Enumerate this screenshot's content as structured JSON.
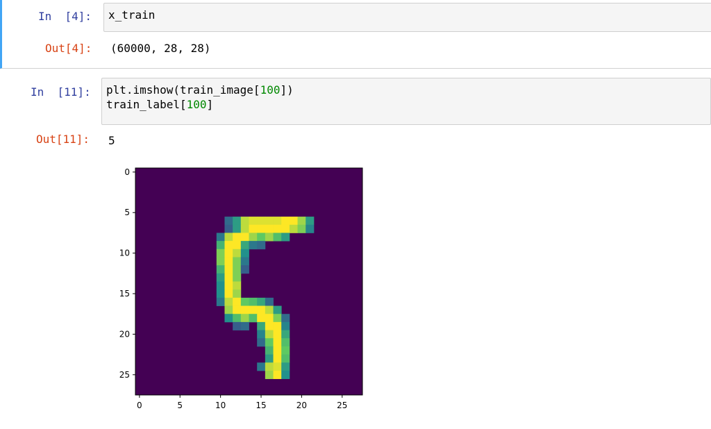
{
  "cells": [
    {
      "in_prompt": "In  [4]:",
      "code_lines": [
        "x_train"
      ],
      "out_prompt": "Out[4]:",
      "output": "(60000, 28, 28)"
    },
    {
      "in_prompt": "In  [11]:",
      "code_line1_a": "plt.imshow(train_image[",
      "code_line1_num": "100",
      "code_line1_b": "])",
      "code_line2_a": "train_label[",
      "code_line2_num": "100",
      "code_line2_b": "]",
      "out_prompt": "Out[11]:",
      "output": "5"
    }
  ],
  "chart_data": {
    "type": "heatmap",
    "title": "",
    "xlabel": "",
    "ylabel": "",
    "xlim": [
      -0.5,
      27.5
    ],
    "ylim": [
      27.5,
      -0.5
    ],
    "x_ticks": [
      0,
      5,
      10,
      15,
      20,
      25
    ],
    "y_ticks": [
      0,
      5,
      10,
      15,
      20,
      25
    ],
    "colormap": "viridis",
    "background_color": "#440154",
    "pixels": [
      [
        6,
        11,
        0.35
      ],
      [
        6,
        12,
        0.55
      ],
      [
        6,
        13,
        0.9
      ],
      [
        6,
        14,
        0.95
      ],
      [
        6,
        15,
        0.95
      ],
      [
        6,
        16,
        0.95
      ],
      [
        6,
        17,
        0.95
      ],
      [
        6,
        18,
        1.0
      ],
      [
        6,
        19,
        1.0
      ],
      [
        6,
        20,
        0.85
      ],
      [
        6,
        21,
        0.55
      ],
      [
        7,
        11,
        0.3
      ],
      [
        7,
        12,
        0.55
      ],
      [
        7,
        13,
        0.9
      ],
      [
        7,
        14,
        1.0
      ],
      [
        7,
        15,
        1.0
      ],
      [
        7,
        16,
        1.0
      ],
      [
        7,
        17,
        1.0
      ],
      [
        7,
        18,
        1.0
      ],
      [
        7,
        19,
        0.9
      ],
      [
        7,
        20,
        0.8
      ],
      [
        7,
        21,
        0.45
      ],
      [
        8,
        10,
        0.4
      ],
      [
        8,
        11,
        0.9
      ],
      [
        8,
        12,
        1.0
      ],
      [
        8,
        13,
        1.0
      ],
      [
        8,
        14,
        0.85
      ],
      [
        8,
        15,
        0.75
      ],
      [
        8,
        16,
        0.85
      ],
      [
        8,
        17,
        0.7
      ],
      [
        8,
        18,
        0.55
      ],
      [
        9,
        10,
        0.65
      ],
      [
        9,
        11,
        1.0
      ],
      [
        9,
        12,
        1.0
      ],
      [
        9,
        13,
        0.6
      ],
      [
        9,
        14,
        0.4
      ],
      [
        9,
        15,
        0.35
      ],
      [
        10,
        10,
        0.8
      ],
      [
        10,
        11,
        1.0
      ],
      [
        10,
        12,
        0.9
      ],
      [
        10,
        13,
        0.5
      ],
      [
        11,
        10,
        0.8
      ],
      [
        11,
        11,
        1.0
      ],
      [
        11,
        12,
        0.8
      ],
      [
        11,
        13,
        0.4
      ],
      [
        12,
        10,
        0.65
      ],
      [
        12,
        11,
        1.0
      ],
      [
        12,
        12,
        0.8
      ],
      [
        12,
        13,
        0.3
      ],
      [
        13,
        10,
        0.55
      ],
      [
        13,
        11,
        1.0
      ],
      [
        13,
        12,
        0.8
      ],
      [
        14,
        10,
        0.5
      ],
      [
        14,
        11,
        1.0
      ],
      [
        14,
        12,
        0.9
      ],
      [
        15,
        10,
        0.5
      ],
      [
        15,
        11,
        1.0
      ],
      [
        15,
        12,
        0.85
      ],
      [
        16,
        10,
        0.4
      ],
      [
        16,
        11,
        0.9
      ],
      [
        16,
        12,
        1.0
      ],
      [
        16,
        13,
        0.75
      ],
      [
        16,
        14,
        0.7
      ],
      [
        16,
        15,
        0.6
      ],
      [
        16,
        16,
        0.35
      ],
      [
        17,
        11,
        0.85
      ],
      [
        17,
        12,
        1.0
      ],
      [
        17,
        13,
        1.0
      ],
      [
        17,
        14,
        1.0
      ],
      [
        17,
        15,
        1.0
      ],
      [
        17,
        16,
        0.9
      ],
      [
        17,
        17,
        0.55
      ],
      [
        18,
        11,
        0.5
      ],
      [
        18,
        12,
        0.7
      ],
      [
        18,
        13,
        0.85
      ],
      [
        18,
        14,
        0.7
      ],
      [
        18,
        15,
        1.0
      ],
      [
        18,
        16,
        1.0
      ],
      [
        18,
        17,
        0.8
      ],
      [
        18,
        18,
        0.35
      ],
      [
        19,
        12,
        0.3
      ],
      [
        19,
        13,
        0.35
      ],
      [
        19,
        15,
        0.6
      ],
      [
        19,
        16,
        1.0
      ],
      [
        19,
        17,
        1.0
      ],
      [
        19,
        18,
        0.45
      ],
      [
        20,
        15,
        0.45
      ],
      [
        20,
        16,
        0.9
      ],
      [
        20,
        17,
        1.0
      ],
      [
        20,
        18,
        0.6
      ],
      [
        21,
        15,
        0.35
      ],
      [
        21,
        16,
        0.75
      ],
      [
        21,
        17,
        1.0
      ],
      [
        21,
        18,
        0.7
      ],
      [
        22,
        16,
        0.65
      ],
      [
        22,
        17,
        1.0
      ],
      [
        22,
        18,
        0.75
      ],
      [
        23,
        16,
        0.55
      ],
      [
        23,
        17,
        1.0
      ],
      [
        23,
        18,
        0.7
      ],
      [
        24,
        15,
        0.4
      ],
      [
        24,
        16,
        0.9
      ],
      [
        24,
        17,
        0.95
      ],
      [
        24,
        18,
        0.55
      ],
      [
        25,
        16,
        0.85
      ],
      [
        25,
        17,
        1.0
      ],
      [
        25,
        18,
        0.5
      ]
    ]
  }
}
